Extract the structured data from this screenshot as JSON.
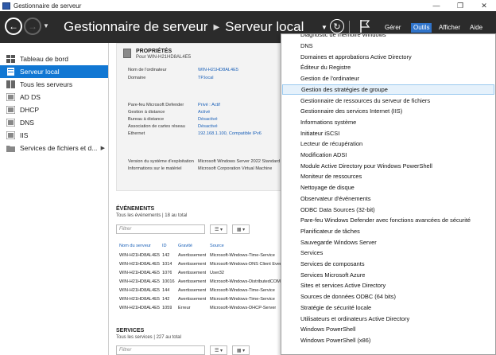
{
  "window": {
    "title": "Gestionnaire de serveur",
    "controls": [
      "—",
      "❐",
      "✕"
    ]
  },
  "header": {
    "breadcrumb_root": "Gestionnaire de serveur",
    "breadcrumb_current": "Serveur local",
    "menus": {
      "manage": "Gérer",
      "tools": "Outils",
      "view": "Afficher",
      "help": "Aide"
    }
  },
  "sidebar": {
    "items": [
      {
        "label": "Tableau de bord"
      },
      {
        "label": "Serveur local"
      },
      {
        "label": "Tous les serveurs"
      },
      {
        "label": "AD DS"
      },
      {
        "label": "DHCP"
      },
      {
        "label": "DNS"
      },
      {
        "label": "IIS"
      },
      {
        "label": "Services de fichiers et d..."
      }
    ]
  },
  "properties": {
    "title": "PROPRIÉTÉS",
    "subtitle": "Pour WIN-H21HD8AL4E5",
    "rows": [
      {
        "label": "Nom de l'ordinateur",
        "value": "WIN-H21HD8AL4E5"
      },
      {
        "label": "Domaine",
        "value": "TP.local"
      },
      {
        "label": "Pare-feu Microsoft Defender",
        "value": "Privé : Actif"
      },
      {
        "label": "Gestion à distance",
        "value": "Activé"
      },
      {
        "label": "Bureau à distance",
        "value": "Désactivé"
      },
      {
        "label": "Association de cartes réseau",
        "value": "Désactivé"
      },
      {
        "label": "Ethernet",
        "value": "192.168.1.100, Compatible IPv6"
      },
      {
        "label": "Version du système d'exploitation",
        "value": "Microsoft Windows Server 2022 Standard Eva"
      },
      {
        "label": "Informations sur le matériel",
        "value": "Microsoft Corporation Virtual Machine"
      }
    ]
  },
  "events": {
    "title": "ÉVÉNEMENTS",
    "subtitle": "Tous les événements | 18 au total",
    "filter_placeholder": "Filtrer",
    "columns": [
      "Nom du serveur",
      "ID",
      "Gravité",
      "Source"
    ],
    "rows": [
      [
        "WIN-H21HD8AL4E5",
        "142",
        "Avertissement",
        "Microsoft-Windows-Time-Service"
      ],
      [
        "WIN-H21HD8AL4E5",
        "1014",
        "Avertissement",
        "Microsoft-Windows-DNS Client Even"
      ],
      [
        "WIN-H21HD8AL4E5",
        "1076",
        "Avertissement",
        "User32"
      ],
      [
        "WIN-H21HD8AL4E5",
        "10016",
        "Avertissement",
        "Microsoft-Windows-DistributedCOM"
      ],
      [
        "WIN-H21HD8AL4E5",
        "144",
        "Avertissement",
        "Microsoft-Windows-Time-Service"
      ],
      [
        "WIN-H21HD8AL4E5",
        "142",
        "Avertissement",
        "Microsoft-Windows-Time-Service"
      ],
      [
        "WIN-H21HD8AL4E5",
        "1059",
        "Erreur",
        "Microsoft-Windows-DHCP-Server"
      ]
    ]
  },
  "services": {
    "title": "SERVICES",
    "subtitle": "Tous les services | 227 au total",
    "filter_placeholder": "Filtrer"
  },
  "tools_menu": {
    "hovered_index": 5,
    "items": [
      "Diagnostic de mémoire Windows",
      "DNS",
      "Domaines et approbations Active Directory",
      "Éditeur du Registre",
      "Gestion de l'ordinateur",
      "Gestion des stratégies de groupe",
      "Gestionnaire de ressources du serveur de fichiers",
      "Gestionnaire des services Internet (IIS)",
      "Informations système",
      "Initiateur iSCSI",
      "Lecteur de récupération",
      "Modification ADSI",
      "Module Active Directory pour Windows PowerShell",
      "Moniteur de ressources",
      "Nettoyage de disque",
      "Observateur d'événements",
      "ODBC Data Sources (32-bit)",
      "Pare-feu Windows Defender avec fonctions avancées de sécurité",
      "Planificateur de tâches",
      "Sauvegarde Windows Server",
      "Services",
      "Services de composants",
      "Services Microsoft Azure",
      "Sites et services Active Directory",
      "Sources de données ODBC (64 bits)",
      "Stratégie de sécurité locale",
      "Utilisateurs et ordinateurs Active Directory",
      "Windows PowerShell",
      "Windows PowerShell (x86)"
    ]
  },
  "colors": {
    "header_bg": "#2b2b2b",
    "selection_blue": "#1177d3",
    "link_blue": "#1a60b8",
    "menu_active": "#2f73c9",
    "hover_bg": "#e5f1fb"
  }
}
